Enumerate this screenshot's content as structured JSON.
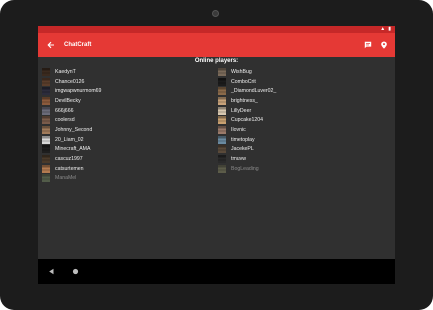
{
  "app": {
    "title": "ChatCraft",
    "colors": {
      "appbar": "#e53935",
      "statusbar": "#c62828",
      "background": "#303030"
    },
    "icons": {
      "back": "arrow-left-icon",
      "chat": "chat-bubble-icon",
      "location": "map-pin-icon"
    }
  },
  "online": {
    "heading": "Online players:",
    "left": [
      {
        "name": "KaedynT",
        "color": "#3b2a1e",
        "away": false
      },
      {
        "name": "Chance0126",
        "color": "#5a3d2b",
        "away": false
      },
      {
        "name": "imgwapwnurmom69",
        "color": "#2c2c3c",
        "away": false
      },
      {
        "name": "DevilBecky",
        "color": "#8b5a3c",
        "away": false
      },
      {
        "name": "666j666",
        "color": "#6b6b7a",
        "away": false
      },
      {
        "name": "coolersd",
        "color": "#7a5b4a",
        "away": false
      },
      {
        "name": "Johnny_Second",
        "color": "#a07a5a",
        "away": false
      },
      {
        "name": "20_Liam_02",
        "color": "#d8d8d8",
        "away": false
      },
      {
        "name": "Minecraft_AMA",
        "color": "#1e1e1e",
        "away": false
      },
      {
        "name": "cascuz1997",
        "color": "#4a3a2a",
        "away": false
      },
      {
        "name": "catsurtemen",
        "color": "#b27a50",
        "away": false
      },
      {
        "name": "ManaMel",
        "color": "#6a7a5a",
        "away": true
      }
    ],
    "right": [
      {
        "name": "WishBug",
        "color": "#7a6a5a",
        "away": false
      },
      {
        "name": "ComboCrit",
        "color": "#1c1c1c",
        "away": false
      },
      {
        "name": "_DiamondLuver02_",
        "color": "#8a6a4a",
        "away": false
      },
      {
        "name": "brightness_",
        "color": "#c7a27a",
        "away": false
      },
      {
        "name": "LillyDeer",
        "color": "#d8c8b0",
        "away": false
      },
      {
        "name": "Cupcake1204",
        "color": "#c8a070",
        "away": false
      },
      {
        "name": "Ilovnic",
        "color": "#9a7a6a",
        "away": false
      },
      {
        "name": "timetoplay",
        "color": "#6a8aa0",
        "away": false
      },
      {
        "name": "JacekePL",
        "color": "#5a4a3a",
        "away": false
      },
      {
        "name": "tmuvw",
        "color": "#2a2a2a",
        "away": false
      },
      {
        "name": "BogLeading",
        "color": "#7a7a5a",
        "away": true
      }
    ]
  },
  "navigation": {
    "icons": [
      "nav-back-triangle-icon",
      "nav-home-circle-icon"
    ]
  }
}
